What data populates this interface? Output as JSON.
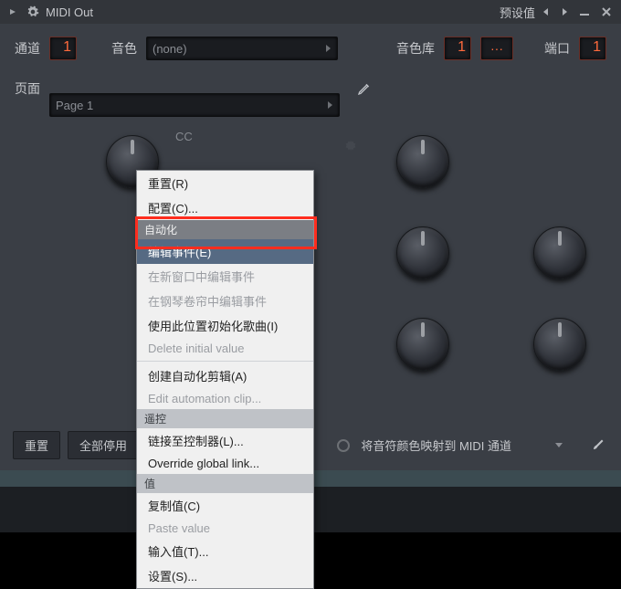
{
  "titlebar": {
    "title": "MIDI Out",
    "preset_label": "预设值"
  },
  "params": {
    "channel_label": "通道",
    "channel_value": "1",
    "patch_label": "音色",
    "patch_value": "(none)",
    "bank_label": "音色库",
    "bank_value": "1",
    "bank_dots": "···",
    "port_label": "端口",
    "port_value": "1"
  },
  "page": {
    "label": "页面",
    "value": "Page 1"
  },
  "knob": {
    "cc_label": "CC"
  },
  "footer": {
    "reset": "重置",
    "stop_all": "全部停用",
    "map_label": "将音符颜色映射到 MIDI 通道"
  },
  "menu": {
    "reset": "重置(R)",
    "configure": "配置(C)...",
    "h_auto": "自动化",
    "edit_events": "编辑事件(E)",
    "edit_new_win": "在新窗口中编辑事件",
    "edit_piano": "在钢琴卷帘中编辑事件",
    "init_song": "使用此位置初始化歌曲(I)",
    "del_init": "Delete initial value",
    "create_auto": "创建自动化剪辑(A)",
    "edit_auto_clip": "Edit automation clip...",
    "h_remote": "遥控",
    "link_ctrl": "链接至控制器(L)...",
    "override": "Override global link...",
    "h_value": "值",
    "copy_val": "复制值(C)",
    "paste_val": "Paste value",
    "type_val": "输入值(T)...",
    "settings": "设置(S)..."
  }
}
